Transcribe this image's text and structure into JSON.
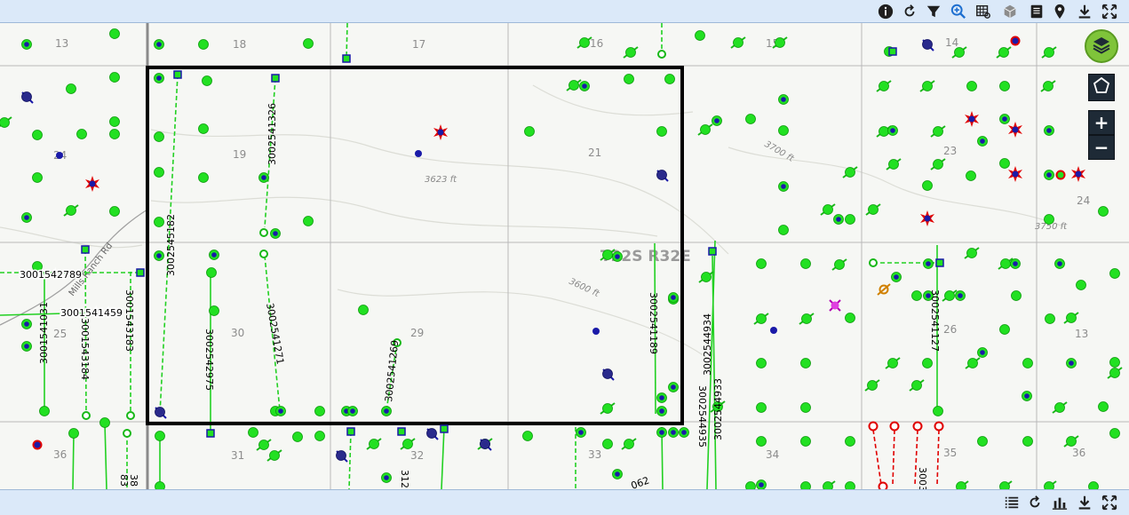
{
  "toolbar": {
    "top_icons": [
      "info-icon",
      "refresh-icon",
      "filter-icon",
      "zoom-search-icon",
      "table-icon",
      "cube-icon",
      "document-icon",
      "map-pin-icon",
      "download-icon",
      "fullscreen-icon"
    ],
    "bottom_icons": [
      "list-icon",
      "refresh-icon",
      "chart-icon",
      "download-icon",
      "fullscreen-icon"
    ]
  },
  "controls": {
    "zoom_in": "+",
    "zoom_out": "−"
  },
  "map": {
    "township_label": "T22S R32E",
    "sections": [
      "13",
      "18",
      "17",
      "16",
      "15",
      "14",
      "24",
      "19",
      "21",
      "23",
      "25",
      "30",
      "29",
      "26",
      "36",
      "31",
      "32",
      "33",
      "34",
      "35"
    ],
    "elevations": [
      "3623 ft",
      "3600 ft",
      "3700 ft",
      "3750 ft"
    ],
    "road_label": "Mills Ranch Rd",
    "well_ids": [
      "3002541326",
      "3002545182",
      "3001542789",
      "3001541459",
      "3001541031",
      "3001543184",
      "3001543183",
      "3002542975",
      "3002541271",
      "3002541269",
      "3002541189",
      "3002544934",
      "3002544933",
      "3002544935",
      "3002541127",
      "3002542792"
    ],
    "bottom_partial_labels": [
      "312",
      "062",
      "3003",
      "83",
      "38"
    ]
  },
  "colors": {
    "well_green": "#22e022",
    "well_blue": "#1a1aa8",
    "flare_red": "#e00000",
    "selection": "#000000",
    "gridline": "#b9b9b9"
  }
}
